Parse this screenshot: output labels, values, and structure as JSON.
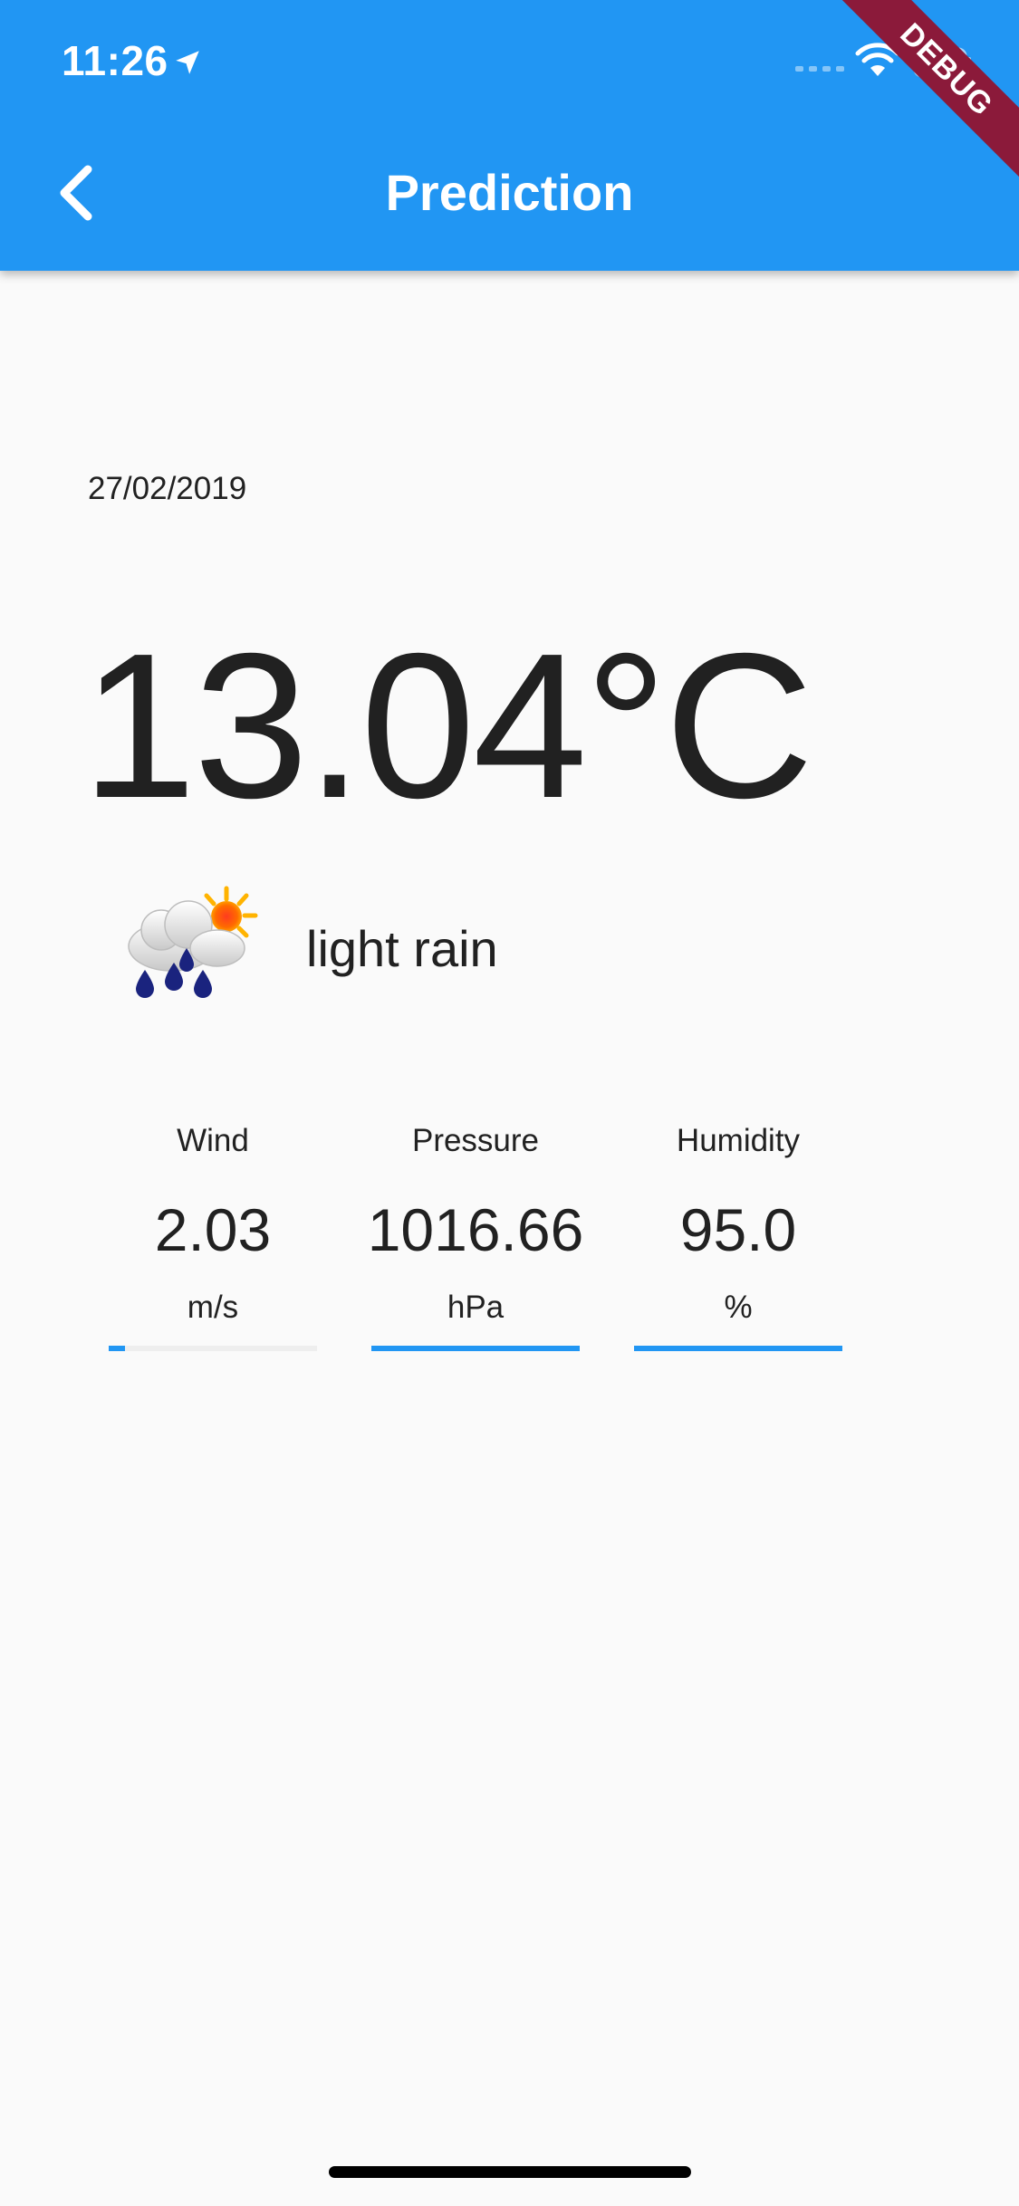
{
  "status_bar": {
    "time": "11:26"
  },
  "app_bar": {
    "title": "Prediction",
    "back_icon": "chevron-left-icon",
    "color": "#2196f3"
  },
  "debug_banner": {
    "label": "DEBUG",
    "color": "#8b1a3a"
  },
  "forecast": {
    "date": "27/02/2019",
    "temperature": "13.04°C",
    "condition_icon": "rain-with-sun-icon",
    "condition": "light rain"
  },
  "metrics": [
    {
      "label": "Wind",
      "value": "2.03",
      "unit": "m/s",
      "progress": 0.08
    },
    {
      "label": "Pressure",
      "value": "1016.66",
      "unit": "hPa",
      "progress": 1.0
    },
    {
      "label": "Humidity",
      "value": "95.0",
      "unit": "%",
      "progress": 1.0
    }
  ],
  "colors": {
    "accent": "#2196f3",
    "track": "#eeeeee",
    "text": "#212121",
    "background": "#fafafa"
  }
}
